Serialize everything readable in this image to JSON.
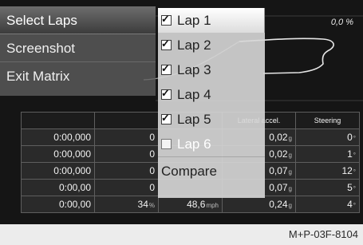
{
  "graph": {
    "percent_label": "0,0 %"
  },
  "table": {
    "headers": [
      "",
      "",
      "",
      "Lateral accel.",
      "Steering"
    ],
    "rows": [
      [
        {
          "v": "0:00,000",
          "u": ""
        },
        {
          "v": "0",
          "u": ""
        },
        {
          "v": "",
          "u": ""
        },
        {
          "v": "0,02",
          "u": "g"
        },
        {
          "v": "0",
          "u": "°"
        }
      ],
      [
        {
          "v": "0:00,000",
          "u": ""
        },
        {
          "v": "0",
          "u": ""
        },
        {
          "v": "",
          "u": ""
        },
        {
          "v": "0,02",
          "u": "g"
        },
        {
          "v": "1",
          "u": "°"
        }
      ],
      [
        {
          "v": "0:00,000",
          "u": ""
        },
        {
          "v": "0",
          "u": ""
        },
        {
          "v": "",
          "u": ""
        },
        {
          "v": "0,07",
          "u": "g"
        },
        {
          "v": "12",
          "u": "°"
        }
      ],
      [
        {
          "v": "0:00,00",
          "u": ""
        },
        {
          "v": "0",
          "u": ""
        },
        {
          "v": "",
          "u": ""
        },
        {
          "v": "0,07",
          "u": "g"
        },
        {
          "v": "5",
          "u": "°"
        }
      ],
      [
        {
          "v": "0:00,00",
          "u": ""
        },
        {
          "v": "34",
          "u": "%"
        },
        {
          "v": "48,6",
          "u": "mph"
        },
        {
          "v": "0,24",
          "u": "g"
        },
        {
          "v": "4",
          "u": "°"
        }
      ]
    ]
  },
  "left_menu": {
    "items": [
      {
        "label": "Select Laps"
      },
      {
        "label": "Screenshot"
      },
      {
        "label": "Exit Matrix"
      }
    ]
  },
  "lap_menu": {
    "items": [
      {
        "label": "Lap 1",
        "checked": true,
        "enabled": true
      },
      {
        "label": "Lap 2",
        "checked": true,
        "enabled": true
      },
      {
        "label": "Lap 3",
        "checked": true,
        "enabled": true
      },
      {
        "label": "Lap 4",
        "checked": true,
        "enabled": true
      },
      {
        "label": "Lap 5",
        "checked": true,
        "enabled": true
      },
      {
        "label": "Lap 6",
        "checked": false,
        "enabled": false
      }
    ],
    "compare_label": "Compare"
  },
  "caption": "M+P-03F-8104",
  "colors": {
    "screen_bg": "#151515",
    "menu_bg": "#5f5f5f",
    "lap_menu_bg": "#d7d7d7",
    "graph_line": "#e6e6e6"
  }
}
